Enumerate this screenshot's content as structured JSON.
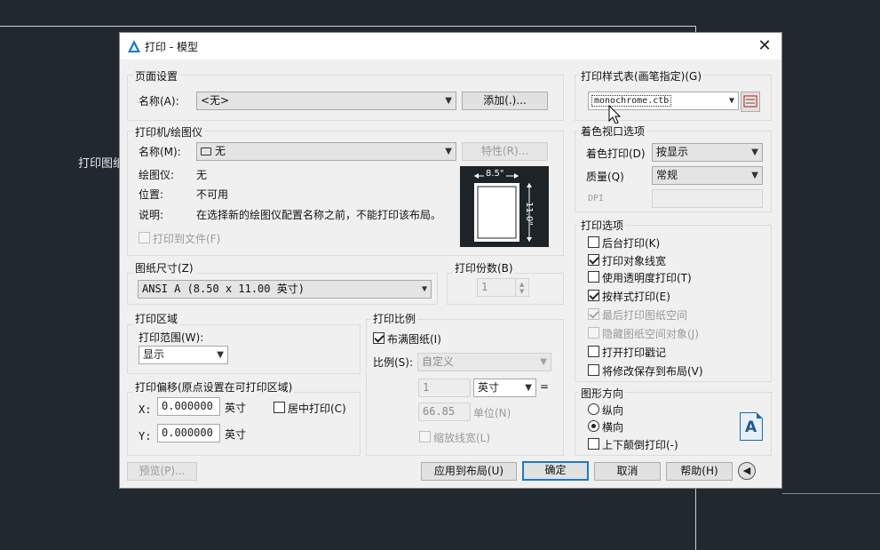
{
  "background": {
    "side_label": "打印图纸"
  },
  "dialog": {
    "title": "打印 - 模型",
    "page_setup": {
      "title": "页面设置",
      "name_label": "名称(A):",
      "name_value": "<无>",
      "add_button": "添加(.)..."
    },
    "printer": {
      "title": "打印机/绘图仪",
      "name_label": "名称(M):",
      "name_value": "无",
      "properties_button": "特性(R)...",
      "plotter_label": "绘图仪:",
      "plotter_value": "无",
      "location_label": "位置:",
      "location_value": "不可用",
      "description_label": "说明:",
      "description_value": "在选择新的绘图仪配置名称之前，不能打印该布局。",
      "print_to_file": "打印到文件(F)",
      "preview_width": "8.5\"",
      "preview_height": "11.0\""
    },
    "paper_size": {
      "title": "图纸尺寸(Z)",
      "value": "ANSI A (8.50 x 11.00 英寸)"
    },
    "copies": {
      "title": "打印份数(B)",
      "value": "1"
    },
    "plot_area": {
      "title": "打印区域",
      "range_label": "打印范围(W):",
      "range_value": "显示"
    },
    "plot_offset": {
      "title": "打印偏移(原点设置在可打印区域)",
      "x_label": "X:",
      "x_value": "0.000000",
      "x_unit": "英寸",
      "y_label": "Y:",
      "y_value": "0.000000",
      "y_unit": "英寸",
      "center_plot": "居中打印(C)"
    },
    "plot_scale": {
      "title": "打印比例",
      "fit_to_paper": "布满图纸(I)",
      "scale_label": "比例(S):",
      "scale_value": "自定义",
      "value1": "1",
      "unit1": "英寸",
      "equals": "=",
      "value2": "66.85",
      "unit2": "单位(N)",
      "scale_lineweights": "缩放线宽(L)"
    },
    "plot_style_table": {
      "title": "打印样式表(画笔指定)(G)",
      "value": "monochrome.ctb"
    },
    "shaded_viewport": {
      "title": "着色视口选项",
      "shade_label": "着色打印(D)",
      "shade_value": "按显示",
      "quality_label": "质量(Q)",
      "quality_value": "常规",
      "dpi_label": "DPI"
    },
    "plot_options": {
      "title": "打印选项",
      "items": [
        {
          "label": "后台打印(K)"
        },
        {
          "label": "打印对象线宽"
        },
        {
          "label": "使用透明度打印(T)"
        },
        {
          "label": "按样式打印(E)"
        },
        {
          "label": "最后打印图纸空间"
        },
        {
          "label": "隐藏图纸空间对象(J)"
        },
        {
          "label": "打开打印戳记"
        },
        {
          "label": "将修改保存到布局(V)"
        }
      ]
    },
    "orientation": {
      "title": "图形方向",
      "portrait": "纵向",
      "landscape": "横向",
      "upside_down": "上下颠倒打印(-)",
      "icon_letter": "A"
    },
    "buttons": {
      "preview": "预览(P)...",
      "apply_to_layout": "应用到布局(U)",
      "ok": "确定",
      "cancel": "取消",
      "help": "帮助(H)"
    },
    "colors": {
      "accent": "#1c79c7",
      "canvas": "#212830"
    }
  }
}
